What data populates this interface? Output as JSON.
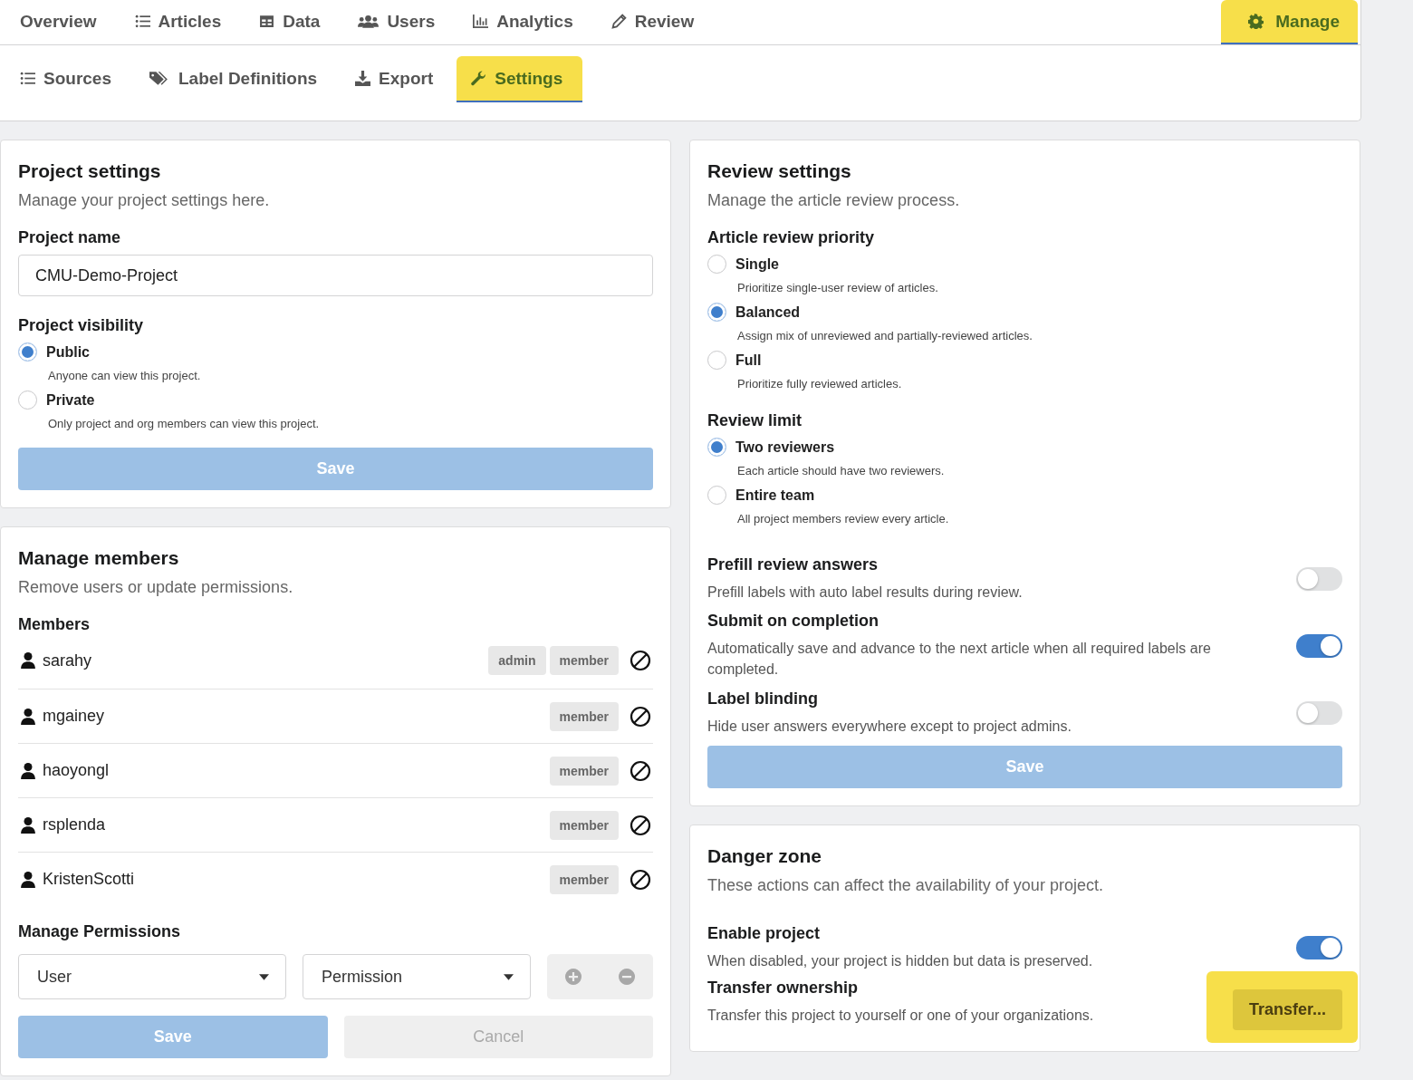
{
  "top_nav": {
    "items": [
      {
        "label": "Overview",
        "selected": false,
        "highlighted": false
      },
      {
        "label": "Articles",
        "selected": false,
        "highlighted": false
      },
      {
        "label": "Data",
        "selected": false,
        "highlighted": false
      },
      {
        "label": "Users",
        "selected": false,
        "highlighted": false
      },
      {
        "label": "Analytics",
        "selected": false,
        "highlighted": false
      },
      {
        "label": "Review",
        "selected": false,
        "highlighted": false
      }
    ],
    "manage": {
      "label": "Manage",
      "selected": true,
      "highlighted": true
    }
  },
  "sub_nav": {
    "items": [
      {
        "label": "Sources",
        "selected": false,
        "highlighted": false
      },
      {
        "label": "Label Definitions",
        "selected": false,
        "highlighted": false
      },
      {
        "label": "Export",
        "selected": false,
        "highlighted": false
      },
      {
        "label": "Settings",
        "selected": true,
        "highlighted": true
      }
    ]
  },
  "project_settings": {
    "title": "Project settings",
    "subtitle": "Manage your project settings here.",
    "name_label": "Project name",
    "name_value": "CMU-Demo-Project",
    "visibility_label": "Project visibility",
    "options": [
      {
        "label": "Public",
        "description": "Anyone can view this project.",
        "selected": true
      },
      {
        "label": "Private",
        "description": "Only project and org members can view this project.",
        "selected": false
      }
    ],
    "save": {
      "label": "Save",
      "disabled": true
    }
  },
  "manage_members": {
    "title": "Manage members",
    "subtitle": "Remove users or update permissions.",
    "members_label": "Members",
    "members": [
      {
        "name": "sarahy",
        "roles": [
          "admin",
          "member"
        ]
      },
      {
        "name": "mgainey",
        "roles": [
          "member"
        ]
      },
      {
        "name": "haoyongl",
        "roles": [
          "member"
        ]
      },
      {
        "name": "rsplenda",
        "roles": [
          "member"
        ]
      },
      {
        "name": "KristenScotti",
        "roles": [
          "member"
        ]
      }
    ],
    "permissions_label": "Manage Permissions",
    "user_select": "User",
    "permission_select": "Permission",
    "save": {
      "label": "Save",
      "disabled": true
    },
    "cancel": {
      "label": "Cancel",
      "disabled": true
    }
  },
  "review_settings": {
    "title": "Review settings",
    "subtitle": "Manage the article review process.",
    "groups": [
      {
        "label": "Article review priority",
        "options": [
          {
            "label": "Single",
            "description": "Prioritize single-user review of articles.",
            "selected": false
          },
          {
            "label": "Balanced",
            "description": "Assign mix of unreviewed and partially-reviewed articles.",
            "selected": true
          },
          {
            "label": "Full",
            "description": "Prioritize fully reviewed articles.",
            "selected": false
          }
        ]
      },
      {
        "label": "Review limit",
        "options": [
          {
            "label": "Two reviewers",
            "description": "Each article should have two reviewers.",
            "selected": true
          },
          {
            "label": "Entire team",
            "description": "All project members review every article.",
            "selected": false
          }
        ]
      }
    ],
    "toggles": [
      {
        "title": "Prefill review answers",
        "description": "Prefill labels with auto label results during review.",
        "on": false
      },
      {
        "title": "Submit on completion",
        "description": "Automatically save and advance to the next article when all required labels are completed.",
        "on": true
      },
      {
        "title": "Label blinding",
        "description": "Hide user answers everywhere except to project admins.",
        "on": false
      }
    ],
    "save": {
      "label": "Save",
      "disabled": true
    }
  },
  "danger_zone": {
    "title": "Danger zone",
    "subtitle": "These actions can affect the availability of your project.",
    "enable": {
      "title": "Enable project",
      "description": "When disabled, your project is hidden but data is preserved.",
      "on": true
    },
    "transfer": {
      "title": "Transfer ownership",
      "description": "Transfer this project to yourself or one of your organizations.",
      "button": "Transfer...",
      "highlighted": true
    }
  }
}
